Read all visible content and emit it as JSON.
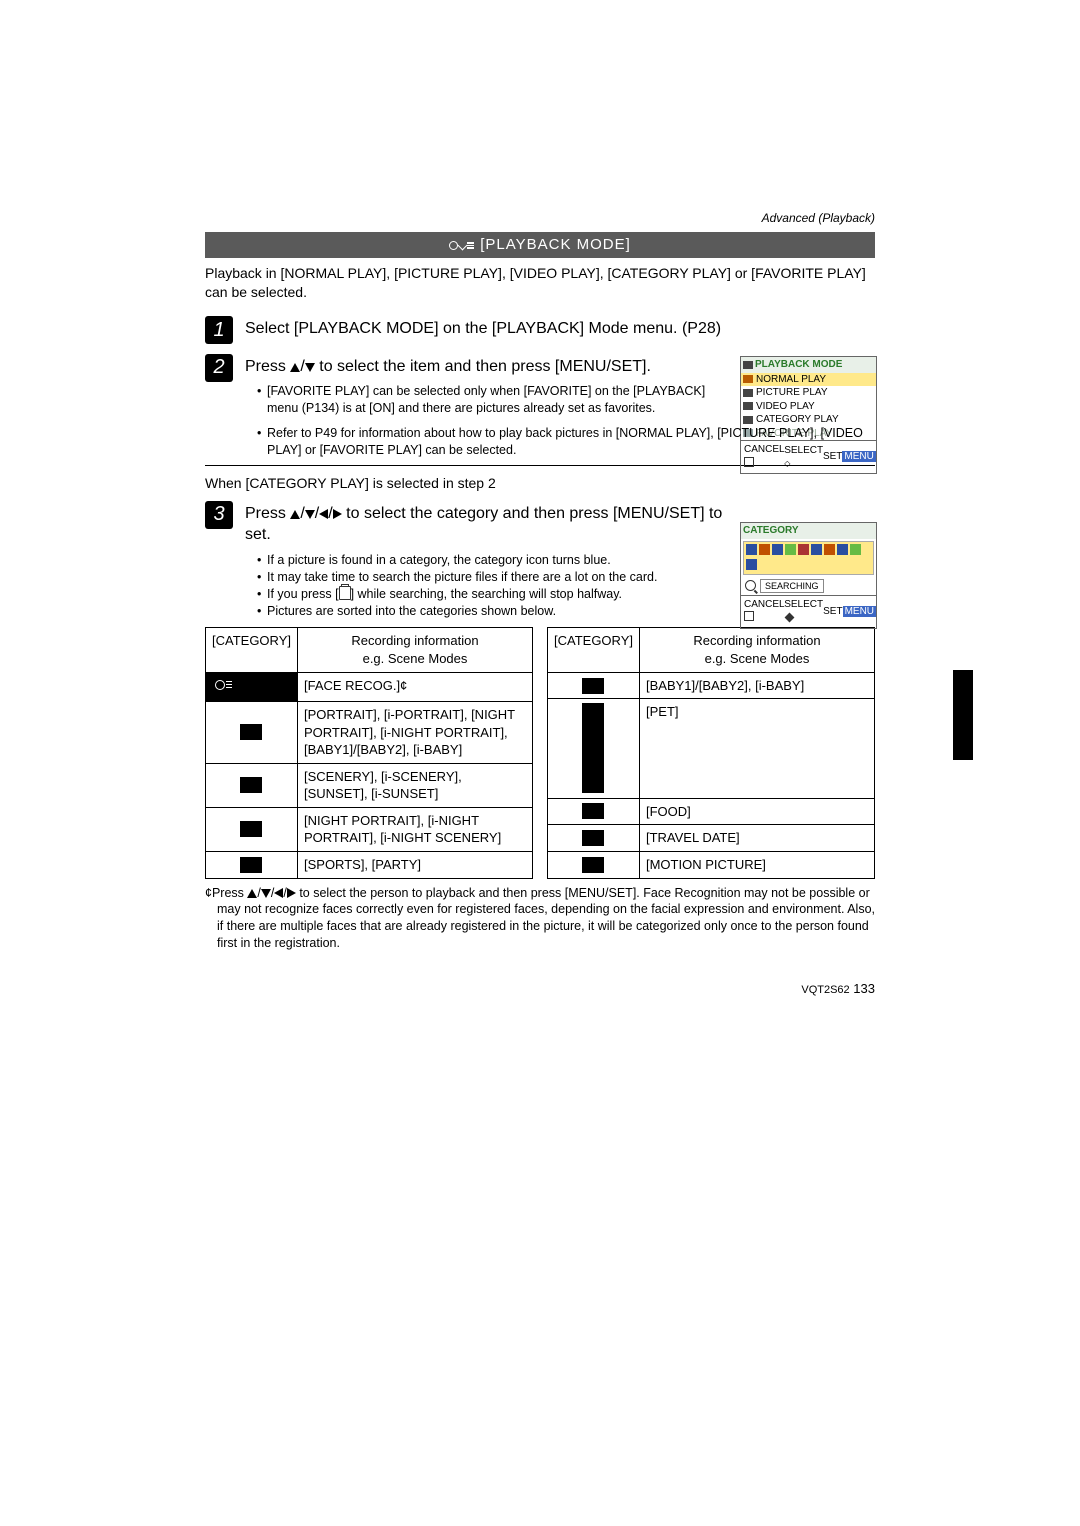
{
  "header": {
    "section": "Advanced (Playback)"
  },
  "title": "[PLAYBACK MODE]",
  "intro": "Playback in [NORMAL PLAY], [PICTURE PLAY], [VIDEO PLAY], [CATEGORY PLAY] or [FAVORITE PLAY] can be selected.",
  "steps": {
    "s1": {
      "num": "1",
      "title": "Select [PLAYBACK MODE] on the [PLAYBACK] Mode menu. (P28)"
    },
    "s2": {
      "num": "2",
      "title_pre": "Press ",
      "title_post": " to select the item and then press [MENU/SET].",
      "b1": "[FAVORITE PLAY] can be selected only when [FAVORITE] on the [PLAYBACK] menu (P134) is at [ON] and there are pictures already set as favorites.",
      "b2": "Refer to P49 for information about how to play back pictures in [NORMAL PLAY], [PICTURE PLAY], [VIDEO PLAY] or [FAVORITE PLAY] can be selected."
    },
    "s3": {
      "num": "3",
      "title_pre": "Press ",
      "title_post": " to select the category and then press [MENU/SET] to set.",
      "b1": "If a picture is found in a category, the category icon turns blue.",
      "b2": "It may take time to search the picture files if there are a lot on the card.",
      "b3_pre": "If you press [",
      "b3_post": "] while searching, the searching will stop halfway.",
      "b4": "Pictures are sorted into the categories shown below."
    }
  },
  "subhead": "When [CATEGORY PLAY] is selected in step 2",
  "table": {
    "h1": "[CATEGORY]",
    "h2a": "Recording information",
    "h2b": "e.g. Scene Modes",
    "left": {
      "r1": "[FACE RECOG.]¢",
      "r2": "[PORTRAIT], [i-PORTRAIT], [NIGHT PORTRAIT], [i-NIGHT PORTRAIT], [BABY1]/[BABY2], [i-BABY]",
      "r3": "[SCENERY], [i-SCENERY], [SUNSET], [i-SUNSET]",
      "r4": "[NIGHT PORTRAIT], [i-NIGHT PORTRAIT], [i-NIGHT SCENERY]",
      "r5": "[SPORTS], [PARTY]"
    },
    "right": {
      "r1": "[BABY1]/[BABY2], [i-BABY]",
      "r2": "[PET]",
      "r3": "[FOOD]",
      "r4": "[TRAVEL DATE]",
      "r5": "[MOTION PICTURE]"
    }
  },
  "footnote_pre": "¢Press ",
  "footnote_post": " to select the person to playback and then press [MENU/SET]. Face Recognition may not be possible or may not recognize faces correctly even for registered faces, depending on the facial expression and environment. Also, if there are multiple faces that are already registered in the picture, it will be categorized only once to the person found first in the registration.",
  "footer": {
    "docid": "VQT2S62",
    "page": "133"
  },
  "screens": {
    "pb": {
      "title": "PLAYBACK MODE",
      "i1": "NORMAL PLAY",
      "i2": "PICTURE PLAY",
      "i3": "VIDEO PLAY",
      "i4": "CATEGORY PLAY",
      "i5": "FAVORITE PLAY",
      "cancel": "CANCEL",
      "select": "SELECT",
      "set": "SET"
    },
    "cat": {
      "title": "CATEGORY",
      "searching": "SEARCHING",
      "cancel": "CANCEL",
      "select": "SELECT",
      "set": "SET"
    }
  }
}
